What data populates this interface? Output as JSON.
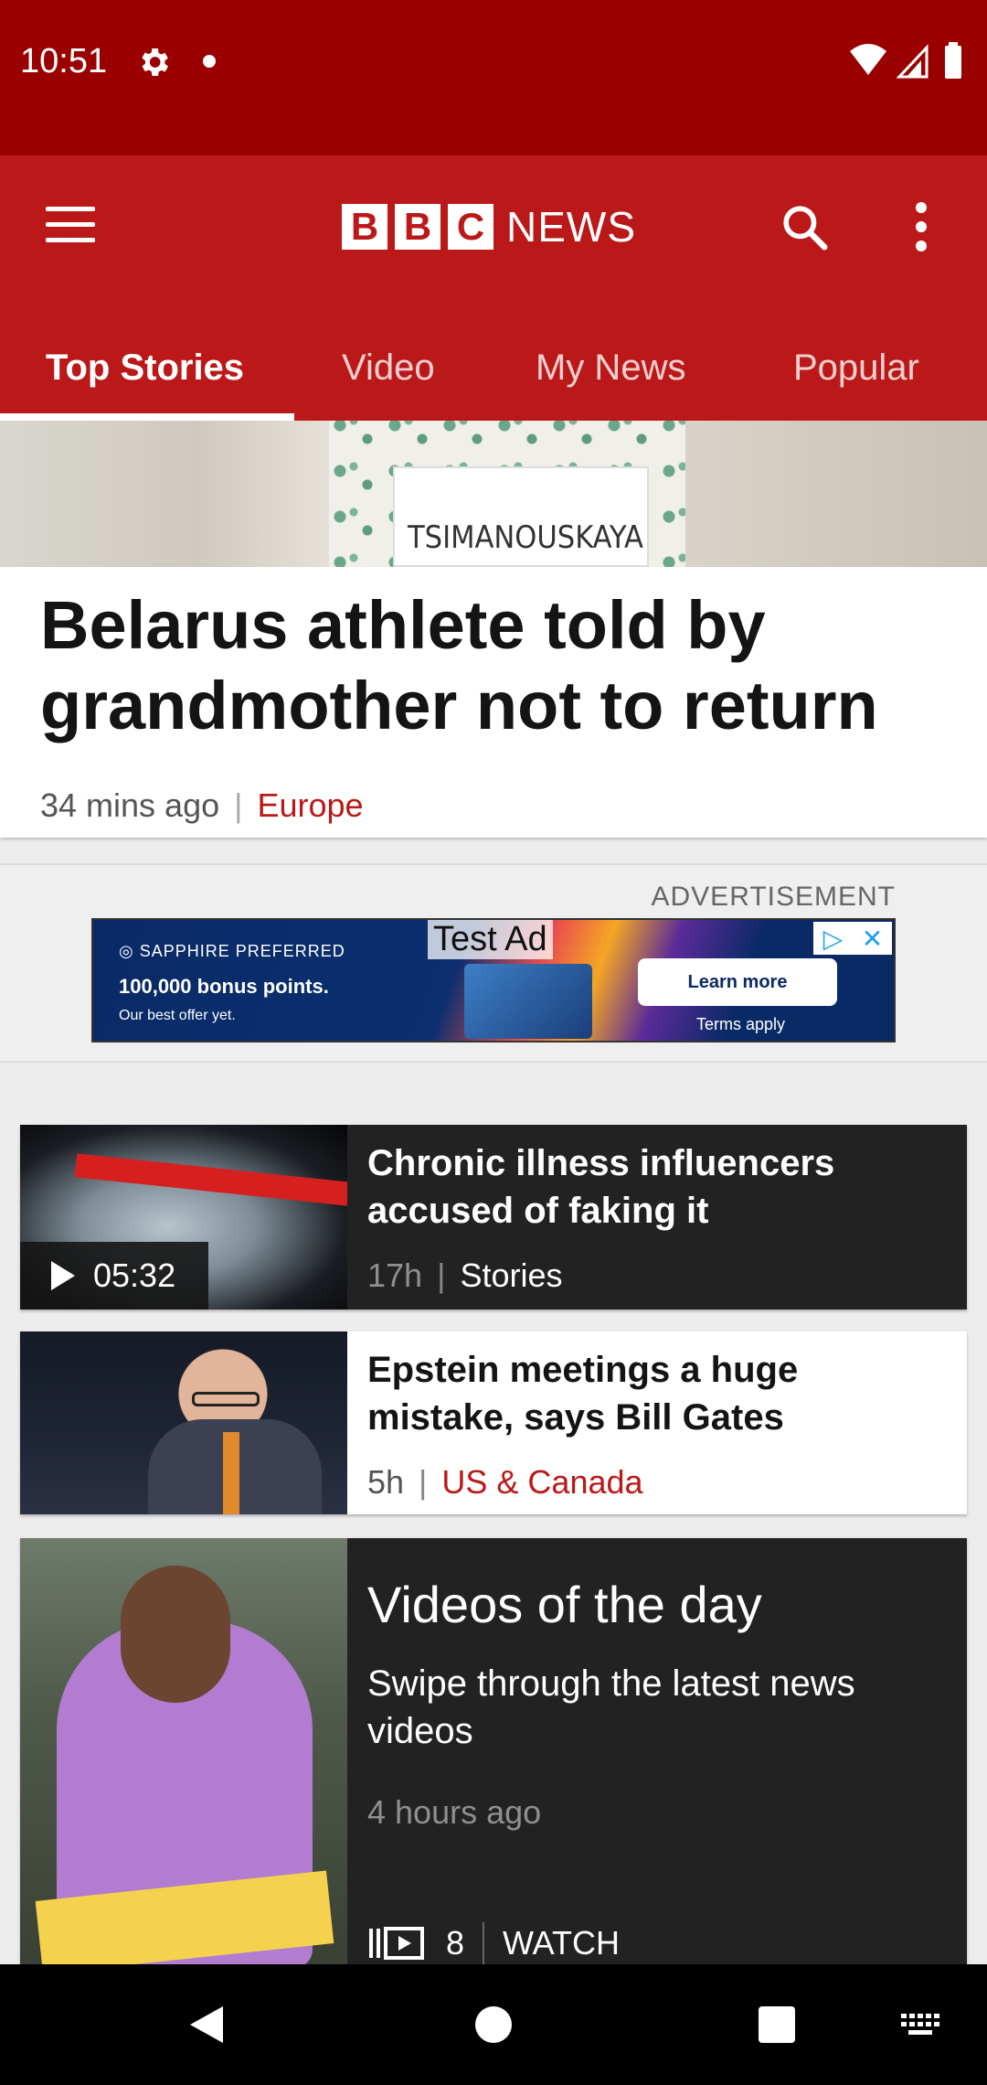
{
  "status_bar": {
    "time": "10:51"
  },
  "app_bar": {
    "logo_text": "NEWS",
    "logo_letters": [
      "B",
      "B",
      "C"
    ]
  },
  "tabs": [
    {
      "label": "Top Stories",
      "active": true
    },
    {
      "label": "Video"
    },
    {
      "label": "My News"
    },
    {
      "label": "Popular"
    }
  ],
  "hero": {
    "image_caption": "TSIMANOUSKAYA",
    "headline": "Belarus athlete told by grandmother not to return",
    "time": "34 mins ago",
    "category": "Europe"
  },
  "ad": {
    "label": "ADVERTISEMENT",
    "test_label": "Test Ad",
    "brand": "SAPPHIRE PREFERRED",
    "headline": "100,000 bonus points.",
    "subline": "Our best offer yet.",
    "cta": "Learn more",
    "terms": "Terms apply"
  },
  "stories": [
    {
      "title": "Chronic illness influencers accused of faking it",
      "time": "17h",
      "category": "Stories",
      "duration": "05:32",
      "theme": "dark"
    },
    {
      "title": "Epstein meetings a huge mistake, says Bill Gates",
      "time": "5h",
      "category": "US & Canada",
      "theme": "light"
    }
  ],
  "videos_of_day": {
    "title": "Videos of the day",
    "subtitle": "Swipe through the latest news videos",
    "time": "4 hours ago",
    "count": "8",
    "action": "WATCH"
  },
  "colors": {
    "brand_red": "#bb1919",
    "status_bar": "#9b0000",
    "dark_card": "#222222"
  }
}
